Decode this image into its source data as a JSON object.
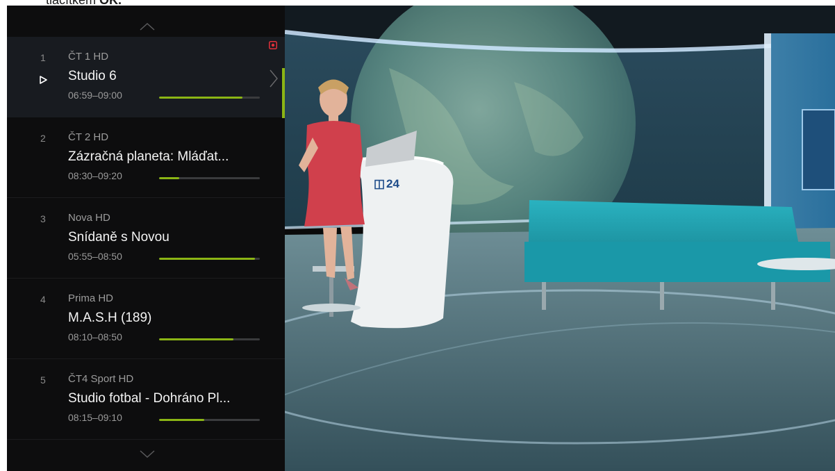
{
  "caption": {
    "text_prefix": "tlačítkem ",
    "text_bold": "OK."
  },
  "channel_list": {
    "channels": [
      {
        "number": "1",
        "name": "ČT 1 HD",
        "title": "Studio 6",
        "time": "06:59–09:00",
        "progress": 0.83,
        "selected": true
      },
      {
        "number": "2",
        "name": "ČT 2 HD",
        "title": "Zázračná planeta: Mláďat...",
        "time": "08:30–09:20",
        "progress": 0.2,
        "selected": false
      },
      {
        "number": "3",
        "name": "Nova HD",
        "title": "Snídaně s Novou",
        "time": "05:55–08:50",
        "progress": 0.95,
        "selected": false
      },
      {
        "number": "4",
        "name": "Prima HD",
        "title": "M.A.S.H (189)",
        "time": "08:10–08:50",
        "progress": 0.74,
        "selected": false
      },
      {
        "number": "5",
        "name": "ČT4 Sport HD",
        "title": "Studio fotbal - Dohráno Pl...",
        "time": "08:15–09:10",
        "progress": 0.45,
        "selected": false
      }
    ]
  },
  "video": {
    "logo_text": "24"
  },
  "colors": {
    "accent": "#8bb515",
    "record": "#e0303a",
    "panel_bg": "#0d0d0e",
    "selected_bg": "#181b20"
  }
}
